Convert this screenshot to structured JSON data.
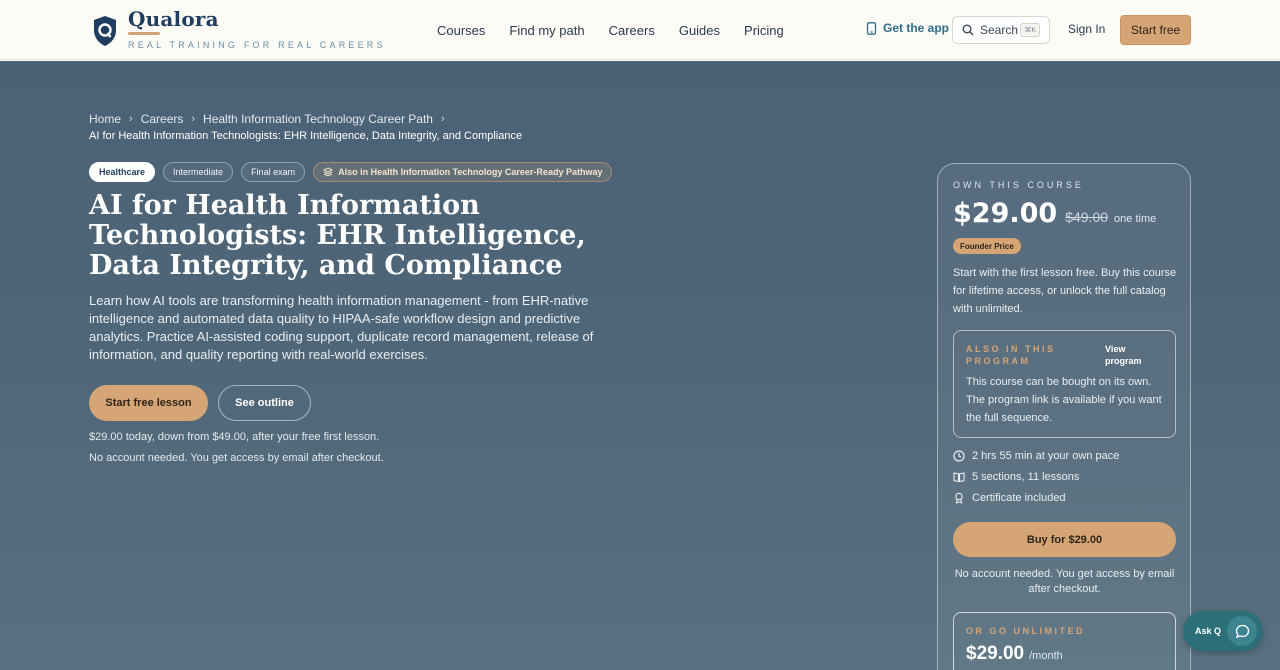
{
  "colors": {
    "brand_navy": "#1f3d5e",
    "accent_tan": "#d6a576",
    "hero_bg": "#4f6678",
    "chat_teal": "#2d6f78"
  },
  "header": {
    "logo_name": "Qualora",
    "logo_tagline": "REAL TRAINING FOR REAL CAREERS",
    "logo_icon": "shield-q-icon",
    "nav": [
      "Courses",
      "Find my path",
      "Careers",
      "Guides",
      "Pricing"
    ],
    "get_app": "Get the app",
    "search_label": "Search",
    "search_shortcut": "⌘K",
    "sign_in": "Sign In",
    "start_free": "Start free"
  },
  "breadcrumb": {
    "items": [
      "Home",
      "Careers",
      "Health Information Technology Career Path"
    ],
    "current": "AI for Health Information Technologists: EHR Intelligence, Data Integrity, and Compliance"
  },
  "tags": {
    "category": "Healthcare",
    "level": "Intermediate",
    "assessment": "Final exam",
    "program": "Also in Health Information Technology Career-Ready Pathway"
  },
  "hero": {
    "title": "AI for Health Information Technologists: EHR Intelligence, Data Integrity, and Compliance",
    "description": "Learn how AI tools are transforming health information management - from EHR-native intelligence and automated data quality to HIPAA-safe workflow design and predictive analytics. Practice AI-assisted coding support, duplicate record management, release of information, and quality reporting with real-world exercises.",
    "primary_cta": "Start free lesson",
    "secondary_cta": "See outline",
    "price_note": "$29.00 today, down from $49.00, after your free first lesson.",
    "account_note": "No account needed. You get access by email after checkout."
  },
  "card": {
    "label": "OWN THIS COURSE",
    "price": "$29.00",
    "old_price": "$49.00",
    "price_suffix": "one time",
    "badge": "Founder Price",
    "description": "Start with the first lesson free. Buy this course for lifetime access, or unlock the full catalog with unlimited.",
    "program": {
      "label": "ALSO IN THIS PROGRAM",
      "link": "View program",
      "description": "This course can be bought on its own. The program link is available if you want the full sequence."
    },
    "features": {
      "duration": "2 hrs 55 min at your own pace",
      "structure": "5 sections, 11 lessons",
      "certificate": "Certificate included"
    },
    "buy_button": "Buy for $29.00",
    "buy_note": "No account needed. You get access by email after checkout.",
    "unlimited": {
      "label": "OR GO UNLIMITED",
      "price": "$29.00",
      "period": "/month"
    }
  },
  "chat": {
    "label": "Ask Q",
    "icon": "chat-bubble-icon"
  }
}
